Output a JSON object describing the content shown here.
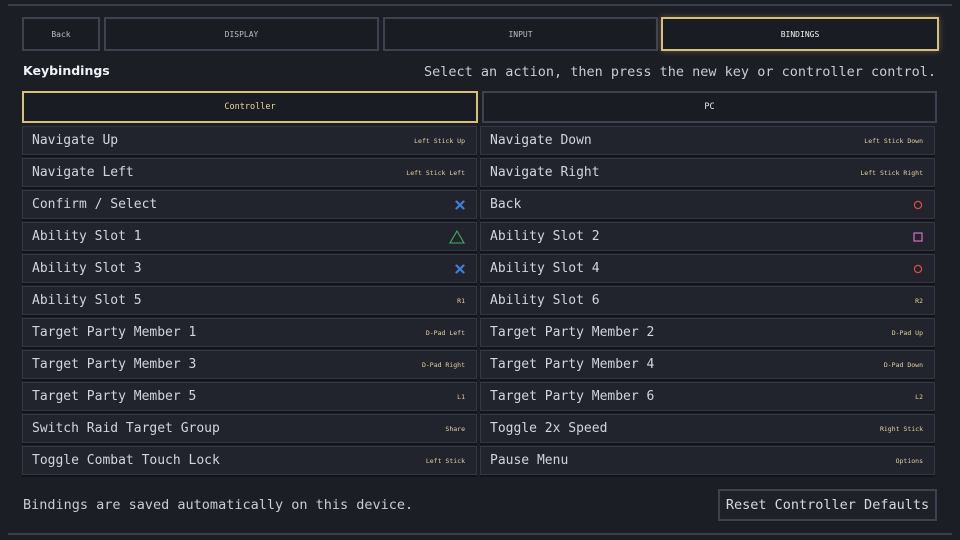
{
  "tabs": {
    "back": "Back",
    "display": "DISPLAY",
    "input": "INPUT",
    "bindings": "BINDINGS"
  },
  "header": {
    "title": "Keybindings",
    "hint": "Select an action, then press the new key or controller control."
  },
  "device_tabs": {
    "controller": "Controller",
    "pc": "PC"
  },
  "bindings": [
    {
      "action": "Navigate Up",
      "key": "Left Stick Up",
      "icon": null
    },
    {
      "action": "Navigate Down",
      "key": "Left Stick Down",
      "icon": null
    },
    {
      "action": "Navigate Left",
      "key": "Left Stick Left",
      "icon": null
    },
    {
      "action": "Navigate Right",
      "key": "Left Stick Right",
      "icon": null
    },
    {
      "action": "Confirm / Select",
      "key": "",
      "icon": "cross"
    },
    {
      "action": "Back",
      "key": "",
      "icon": "circle"
    },
    {
      "action": "Ability Slot 1",
      "key": "",
      "icon": "triangle"
    },
    {
      "action": "Ability Slot 2",
      "key": "",
      "icon": "square"
    },
    {
      "action": "Ability Slot 3",
      "key": "",
      "icon": "cross"
    },
    {
      "action": "Ability Slot 4",
      "key": "",
      "icon": "circle"
    },
    {
      "action": "Ability Slot 5",
      "key": "R1",
      "icon": null
    },
    {
      "action": "Ability Slot 6",
      "key": "R2",
      "icon": null
    },
    {
      "action": "Target Party Member 1",
      "key": "D-Pad Left",
      "icon": null
    },
    {
      "action": "Target Party Member 2",
      "key": "D-Pad Up",
      "icon": null
    },
    {
      "action": "Target Party Member 3",
      "key": "D-Pad Right",
      "icon": null
    },
    {
      "action": "Target Party Member 4",
      "key": "D-Pad Down",
      "icon": null
    },
    {
      "action": "Target Party Member 5",
      "key": "L1",
      "icon": null
    },
    {
      "action": "Target Party Member 6",
      "key": "L2",
      "icon": null
    },
    {
      "action": "Switch Raid Target Group",
      "key": "Share",
      "icon": null
    },
    {
      "action": "Toggle 2x Speed",
      "key": "Right Stick",
      "icon": null
    },
    {
      "action": "Toggle Combat Touch Lock",
      "key": "Left Stick",
      "icon": null
    },
    {
      "action": "Pause Menu",
      "key": "Options",
      "icon": null
    }
  ],
  "icon_colors": {
    "cross": "#3f7fdc",
    "circle": "#e04848",
    "triangle": "#3fae5a",
    "square": "#d66fc4"
  },
  "accent": "#d9c079",
  "footer": {
    "note": "Bindings are saved automatically on this device.",
    "reset_label": "Reset Controller Defaults"
  }
}
